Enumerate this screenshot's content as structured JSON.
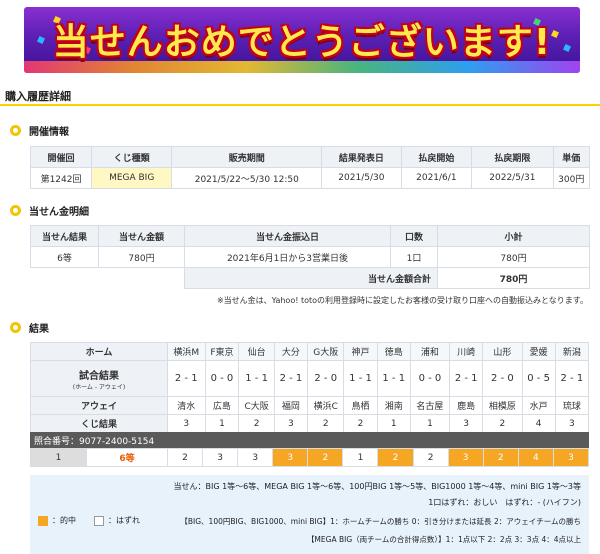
{
  "banner": {
    "title": "当せんおめでとうございます!"
  },
  "page_title": "購入履歴詳細",
  "sections": {
    "info": "開催情報",
    "win": "当せん金明細",
    "result": "結果"
  },
  "info_table": {
    "headers": [
      "開催回",
      "くじ種類",
      "販売期間",
      "結果発表日",
      "払戻開始",
      "払戻期限",
      "単価"
    ],
    "row": [
      "第1242回",
      "MEGA BIG",
      "2021/5/22〜5/30 12:50",
      "2021/5/30",
      "2021/6/1",
      "2022/5/31",
      "300円"
    ]
  },
  "win_table": {
    "headers": [
      "当せん結果",
      "当せん金額",
      "当せん金振込日",
      "口数",
      "小計"
    ],
    "row": [
      "6等",
      "780円",
      "2021年6月1日から3営業日後",
      "1口",
      "780円"
    ],
    "total_label": "当せん金額合計",
    "total_value": "780円"
  },
  "note": "※当せん金は、Yahoo! totoの利用登録時に設定したお客様の受け取り口座への自動振込みとなります。",
  "results": {
    "home_label": "ホーム",
    "score_label": "試合結果",
    "score_sub": "(ホーム - アウェイ)",
    "away_label": "アウェイ",
    "kuji_label": "くじ結果",
    "home": [
      "横浜M",
      "F東京",
      "仙台",
      "大分",
      "G大阪",
      "神戸",
      "徳島",
      "浦和",
      "川崎",
      "山形",
      "愛媛",
      "新潟"
    ],
    "scores": [
      "2 - 1",
      "0 - 0",
      "1 - 1",
      "2 - 1",
      "2 - 0",
      "1 - 1",
      "1 - 1",
      "0 - 0",
      "2 - 1",
      "2 - 0",
      "0 - 5",
      "2 - 1"
    ],
    "away": [
      "清水",
      "広島",
      "C大阪",
      "福岡",
      "横浜C",
      "鳥栖",
      "湘南",
      "名古屋",
      "鹿島",
      "相模原",
      "水戸",
      "琉球"
    ],
    "kuji": [
      "3",
      "1",
      "2",
      "3",
      "2",
      "2",
      "1",
      "1",
      "3",
      "2",
      "4",
      "3"
    ]
  },
  "ticket": {
    "ref_label": "照合番号：9077-2400-5154",
    "index": "1",
    "rank": "6等",
    "picks": [
      "2",
      "3",
      "3",
      "3",
      "2",
      "1",
      "2",
      "2",
      "3",
      "2",
      "4",
      "3"
    ],
    "hits": [
      false,
      false,
      false,
      true,
      true,
      false,
      true,
      false,
      true,
      true,
      true,
      true
    ]
  },
  "legend": {
    "line1": "当せん：BIG 1等〜6等、MEGA BIG 1等〜6等、100円BIG 1等〜5等、BIG1000 1等〜4等、mini BIG 1等〜3等",
    "line2": "1口はずれ：おしい　はずれ：- (ハイフン)",
    "hit_label": "：的中",
    "miss_label": "：はずれ",
    "line3": "【BIG、100円BIG、BIG1000、mini BIG】1：ホームチームの勝ち 0：引き分けまたは延長 2：アウェイチームの勝ち",
    "line4": "【MEGA BIG（両チームの合計得点数）】1：1点以下 2：2点 3：3点 4：4点以上",
    "hit_color": "#f5a623"
  }
}
